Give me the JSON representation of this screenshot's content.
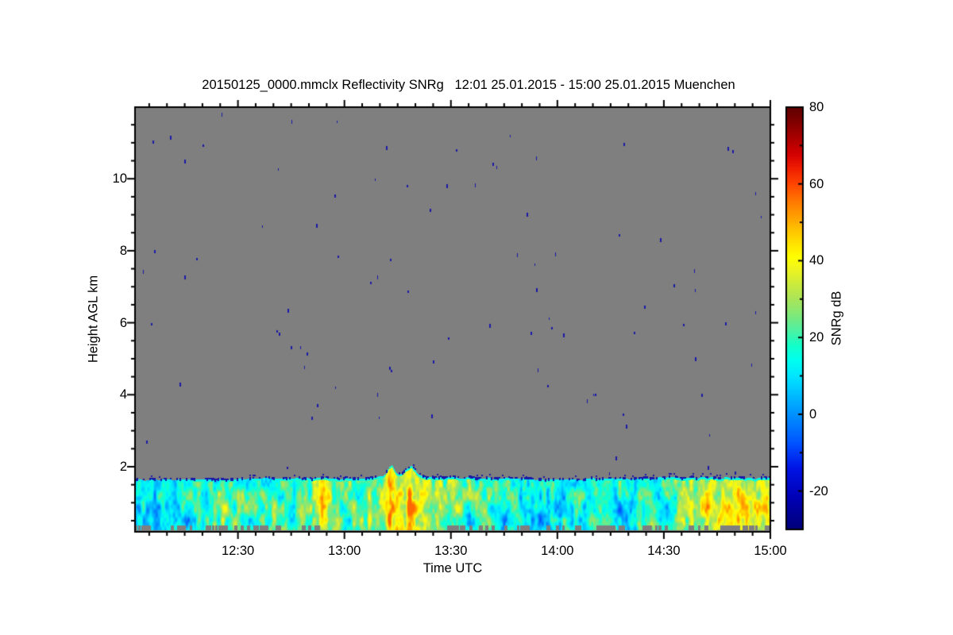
{
  "chart_data": {
    "type": "heatmap",
    "title": "20150125_0000.mmclx Reflectivity SNRg   12:01 25.01.2015 - 15:00 25.01.2015 Muenchen",
    "xlabel": "Time UTC",
    "ylabel": "Height AGL km",
    "colorbar_label": "SNRg dB",
    "x_start": "12:01",
    "x_end": "15:00",
    "x_ticks": [
      "12:30",
      "13:00",
      "13:30",
      "14:00",
      "14:30",
      "15:00"
    ],
    "x_minor_tick_minutes": 5,
    "y_range_km": [
      0.19,
      12.0
    ],
    "y_ticks_km": [
      2,
      4,
      6,
      8,
      10
    ],
    "y_minor_tick_km": 0.5,
    "colorbar_range_db": [
      -30,
      80
    ],
    "colorbar_ticks_db": [
      80,
      60,
      40,
      20,
      0,
      -20
    ],
    "colorbar_minor_tick_db": 10,
    "grid": false,
    "no_signal_color": "#7f7f7f",
    "axis_color": "#000000",
    "noise_dot_color": "#1a1aa8",
    "noise_dot_count": 92,
    "colormap_stops": [
      [
        -30,
        "#000078"
      ],
      [
        -22,
        "#0000b4"
      ],
      [
        -14,
        "#0014e6"
      ],
      [
        -8,
        "#0050ff"
      ],
      [
        -2,
        "#0082ff"
      ],
      [
        4,
        "#00b4ff"
      ],
      [
        10,
        "#00e6ff"
      ],
      [
        14,
        "#00fff0"
      ],
      [
        18,
        "#14ffc8"
      ],
      [
        22,
        "#50f0a0"
      ],
      [
        26,
        "#82e878"
      ],
      [
        30,
        "#aae55a"
      ],
      [
        34,
        "#cdeb3c"
      ],
      [
        38,
        "#f0f51e"
      ],
      [
        41,
        "#ffff00"
      ],
      [
        44,
        "#ffe600"
      ],
      [
        48,
        "#ffc300"
      ],
      [
        52,
        "#ff9b00"
      ],
      [
        56,
        "#ff7300"
      ],
      [
        60,
        "#ff4600"
      ],
      [
        64,
        "#f01e00"
      ],
      [
        68,
        "#d20000"
      ],
      [
        72,
        "#aa0000"
      ],
      [
        76,
        "#820000"
      ],
      [
        80,
        "#5f0000"
      ]
    ],
    "boundary_layer": {
      "description": "Boundary-layer signal band below ~1.7 km AGL; gray above is no-signal with sparse receiver-noise pixels; gray dashes at bottom are ground clutter",
      "top_height_km_profile": [
        [
          0,
          1.63
        ],
        [
          15,
          1.64
        ],
        [
          30,
          1.66
        ],
        [
          45,
          1.68
        ],
        [
          58,
          1.66
        ],
        [
          65,
          1.68
        ],
        [
          70,
          1.73
        ],
        [
          71.5,
          1.95
        ],
        [
          72.5,
          2.03
        ],
        [
          73.5,
          1.85
        ],
        [
          75,
          1.78
        ],
        [
          76.5,
          1.95
        ],
        [
          78,
          2.0
        ],
        [
          79.5,
          1.8
        ],
        [
          82,
          1.72
        ],
        [
          90,
          1.7
        ],
        [
          100,
          1.67
        ],
        [
          115,
          1.65
        ],
        [
          130,
          1.66
        ],
        [
          145,
          1.68
        ],
        [
          160,
          1.7
        ],
        [
          170,
          1.69
        ],
        [
          179,
          1.67
        ]
      ],
      "mean_snr_db_profile": [
        [
          0,
          13
        ],
        [
          6,
          11
        ],
        [
          14,
          14
        ],
        [
          22,
          18
        ],
        [
          27,
          21
        ],
        [
          33,
          16
        ],
        [
          42,
          18
        ],
        [
          50,
          24
        ],
        [
          54,
          30
        ],
        [
          59,
          21
        ],
        [
          65,
          24
        ],
        [
          70,
          30
        ],
        [
          73,
          36
        ],
        [
          76,
          34
        ],
        [
          79,
          38
        ],
        [
          83,
          27
        ],
        [
          88,
          26
        ],
        [
          95,
          22
        ],
        [
          101,
          20
        ],
        [
          108,
          16
        ],
        [
          115,
          13
        ],
        [
          124,
          13
        ],
        [
          133,
          14
        ],
        [
          140,
          17
        ],
        [
          147,
          21
        ],
        [
          153,
          26
        ],
        [
          158,
          31
        ],
        [
          163,
          35
        ],
        [
          169,
          36
        ],
        [
          175,
          36
        ],
        [
          179,
          34
        ]
      ],
      "features": [
        {
          "t": 3.5,
          "h": 0.45,
          "dt": 3.0,
          "dh": 0.33,
          "snr": -12
        },
        {
          "t": 15,
          "h": 0.45,
          "dt": 2.5,
          "dh": 0.3,
          "snr": -9
        },
        {
          "t": 25,
          "h": 0.9,
          "dt": 1.2,
          "dh": 0.8,
          "snr": 10
        },
        {
          "t": 39,
          "h": 0.9,
          "dt": 1.3,
          "dh": 0.8,
          "snr": 9
        },
        {
          "t": 53,
          "h": 0.9,
          "dt": 1.3,
          "dh": 0.9,
          "snr": 13
        },
        {
          "t": 72,
          "h": 0.9,
          "dt": 1.4,
          "dh": 0.9,
          "snr": 19
        },
        {
          "t": 77.5,
          "h": 0.7,
          "dt": 1.1,
          "dh": 0.8,
          "snr": 21
        },
        {
          "t": 95,
          "h": 0.5,
          "dt": 2.2,
          "dh": 0.3,
          "snr": -12
        },
        {
          "t": 104,
          "h": 0.55,
          "dt": 3.0,
          "dh": 0.32,
          "snr": -14
        },
        {
          "t": 113,
          "h": 0.6,
          "dt": 2.5,
          "dh": 0.35,
          "snr": -14
        },
        {
          "t": 137,
          "h": 0.8,
          "dt": 2.5,
          "dh": 0.4,
          "snr": -16
        },
        {
          "t": 149,
          "h": 0.75,
          "dt": 2.5,
          "dh": 0.42,
          "snr": -16
        },
        {
          "t": 160,
          "h": 0.9,
          "dt": 2.5,
          "dh": 0.35,
          "snr": 12
        },
        {
          "t": 170,
          "h": 0.85,
          "dt": 4.5,
          "dh": 0.4,
          "snr": 9
        }
      ],
      "clutter_segments_min": [
        [
          0,
          4
        ],
        [
          10,
          16
        ],
        [
          19,
          41
        ],
        [
          47,
          52
        ],
        [
          88,
          101
        ],
        [
          104,
          112
        ],
        [
          116,
          126
        ],
        [
          130,
          139
        ],
        [
          143,
          151
        ],
        [
          155,
          162
        ],
        [
          165,
          179
        ]
      ]
    }
  }
}
